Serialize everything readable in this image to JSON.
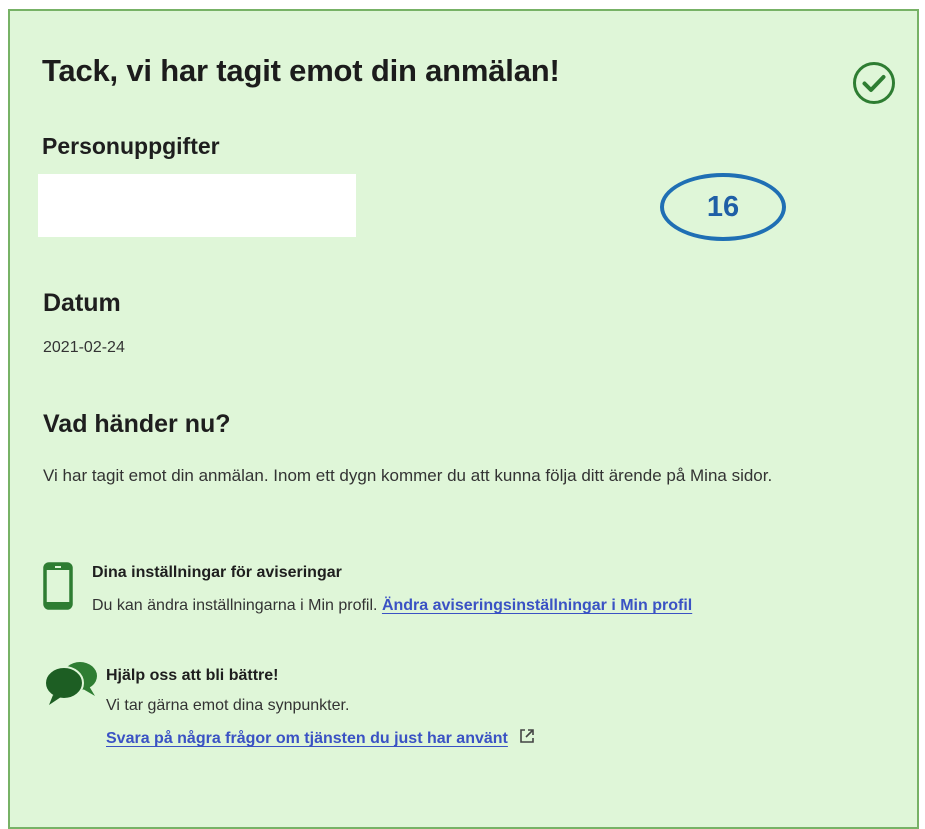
{
  "header": {
    "title": "Tack, vi har tagit emot din anmälan!"
  },
  "personal": {
    "heading": "Personuppgifter"
  },
  "annotation": {
    "badge_number": "16"
  },
  "date_section": {
    "heading": "Datum",
    "value": "2021-02-24"
  },
  "next": {
    "heading": "Vad händer nu?",
    "text": "Vi har tagit emot din anmälan. Inom ett dygn kommer du att kunna följa ditt ärende på Mina sidor."
  },
  "notifications": {
    "icon": "phone-icon",
    "title": "Dina inställningar för aviseringar",
    "text": "Du kan ändra inställningarna i Min profil.",
    "link": "Ändra aviseringsinställningar i Min profil"
  },
  "feedback": {
    "icon": "speech-bubbles-icon",
    "title": "Hjälp oss att bli bättre!",
    "text": "Vi tar gärna emot dina synpunkter.",
    "link": "Svara på några frågor om tjänsten du just har använt",
    "link_icon": "external-link-icon"
  },
  "colors": {
    "card_background": "#dff6d8",
    "accent_green": "#2e7d32",
    "link": "#3a52c4",
    "badge_blue": "#1f6fb4"
  }
}
